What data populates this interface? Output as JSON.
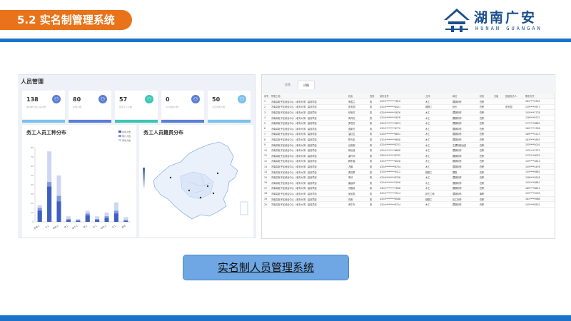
{
  "slide": {
    "title": "5.2 实名制管理系统",
    "caption": "实名制人员管理系统",
    "logo_cn": "湖南广安",
    "logo_en": "HUNAN GUANGAN",
    "colors": {
      "accent": "#e8731a",
      "band": "#1b73c9",
      "caption_bg": "#6ea7e3"
    }
  },
  "left_panel": {
    "title": "人员管理",
    "cards": [
      {
        "value": "138",
        "label": "本月累计进入总人数",
        "icon": "user-icon",
        "icon_color": "#5b7fd6",
        "bar_color": "#7cc2ea"
      },
      {
        "value": "80",
        "label": "在场人数",
        "icon": "user-icon",
        "icon_color": "#5b7fd6",
        "bar_color": "#5b7fd6"
      },
      {
        "value": "57",
        "label": "在场工人人数",
        "icon": "user-icon",
        "icon_color": "#3cc6b4",
        "bar_color": "#3cc6b4"
      },
      {
        "value": "0",
        "label": "今日进场人数",
        "icon": "user-icon",
        "icon_color": "#5b7fd6",
        "bar_color": "#5b7fd6"
      },
      {
        "value": "50",
        "label": "今日出场人数",
        "icon": "user-icon",
        "icon_color": "#7cc2ea",
        "bar_color": "#7cc2ea"
      }
    ],
    "worker_chart_title": "务工人员工种分布",
    "map_title": "务工人员籍贯分布"
  },
  "chart_data": {
    "type": "bar",
    "title": "务工人员工种分布",
    "categories": [
      "普通工",
      "木工",
      "钢筋工",
      "电工",
      "架子工",
      "焊工",
      "杂工",
      "砌筑工",
      "瓦工",
      "其他"
    ],
    "ylim": [
      0,
      80
    ],
    "yticks": [
      0,
      10,
      20,
      30,
      40,
      50,
      60,
      70,
      80
    ],
    "series": [
      {
        "name": "在场人数",
        "values": [
          12,
          38,
          22,
          2,
          1,
          7,
          2,
          4,
          9,
          1
        ],
        "color": "#3e5fbf"
      },
      {
        "name": "累计人数",
        "values": [
          15,
          43,
          28,
          3,
          2,
          9,
          3,
          6,
          12,
          2
        ],
        "color": "#7f98de"
      },
      {
        "name": "离场人数",
        "values": [
          18,
          76,
          50,
          6,
          3,
          12,
          6,
          10,
          21,
          5
        ],
        "color": "#cdd7f2"
      }
    ]
  },
  "right_panel": {
    "tabs": [
      "总览",
      "详情"
    ],
    "active_tab": 1,
    "columns": [
      "序号",
      "所属工地",
      "姓名",
      "性别",
      "身份证号",
      "工种",
      "岗位",
      "状态",
      "分组",
      "班组负责人",
      "联系方式"
    ],
    "rows": [
      [
        "1",
        "济南高老子区综合中心（老年大学）建设项目",
        "朱胜兰",
        "男",
        "4324********7810",
        "木工",
        "镶钢制作",
        "在职",
        "",
        "",
        "181****5301"
      ],
      [
        "2",
        "济南高老子区综合中心（老年大学）建设项目",
        "张天国",
        "男",
        "4324********8421",
        "钢筋工",
        "班长",
        "在职",
        "",
        "张天国",
        "139****0977"
      ],
      [
        "3",
        "济南高老子区综合中心（老年大学）建设项目",
        "何序红",
        "男",
        "4324********5876",
        "木工",
        "镶钢制作",
        "在职",
        "",
        "",
        "155****7778"
      ],
      [
        "4",
        "济南高老子区综合中心（老年大学）建设项目",
        "周开红",
        "男",
        "4324********5876",
        "木工",
        "镶钢制作",
        "在职",
        "",
        "",
        "138****8722"
      ],
      [
        "5",
        "济南高老子区综合中心（老年大学）建设项目",
        "罗茂文",
        "男",
        "4324********5874",
        "木工",
        "镶钢制作",
        "在职",
        "",
        "",
        "177****8881"
      ],
      [
        "6",
        "济南高老子区综合中心（老年大学）建设项目",
        "庞新方",
        "男",
        "4324********6770",
        "木工",
        "镶钢制作",
        "在职",
        "",
        "",
        "180****1558"
      ],
      [
        "7",
        "济南高老子区综合中心（老年大学）建设项目",
        "温红生",
        "男",
        "4324********8831",
        "木工",
        "镶钢制作",
        "在职",
        "",
        "",
        "189****4213"
      ],
      [
        "8",
        "济南高老子区综合中心（老年大学）建设项目",
        "陈光友",
        "男",
        "4324********9808",
        "木工",
        "镶钢制作",
        "在职",
        "",
        "",
        "183****5655"
      ],
      [
        "9",
        "济南高老子区综合中心（老年大学）建设项目",
        "吕则权",
        "男",
        "4324********8751",
        "木工",
        "主镶制部运送",
        "在职",
        "",
        "",
        "155****5001"
      ],
      [
        "10",
        "济南高老子区综合中心（老年大学）建设项目",
        "胡世建",
        "男",
        "4324********8808",
        "木工",
        "镶钢制作",
        "在职",
        "",
        "",
        "155****2375"
      ],
      [
        "11",
        "济南高老子区综合中心（老年大学）建设项目",
        "谢玲华",
        "男",
        "4324********8732",
        "木工",
        "镶钢制作",
        "在职",
        "",
        "",
        "173****6025"
      ],
      [
        "12",
        "济南高老子区综合中心（老年大学）建设项目",
        "滕冬福",
        "男",
        "4324********8528",
        "木工",
        "镶钢制作",
        "在职",
        "",
        "",
        "135****0813"
      ],
      [
        "13",
        "济南高老子区综合中心（老年大学）建设项目",
        "方鹏",
        "男",
        "4324********8734",
        "木工",
        "镶钢制作",
        "在职",
        "",
        "",
        "155****4476"
      ],
      [
        "14",
        "济南高老子区综合中心（老年大学）建设项目",
        "曹四季",
        "男",
        "4324********8412",
        "钢筋工",
        "镶筋",
        "在职",
        "",
        "",
        "155****6661"
      ],
      [
        "15",
        "济南高老子区综合中心（老年大学）建设项目",
        "朱好",
        "男",
        "4324********8758",
        "木工",
        "镶钢制作",
        "在职",
        "",
        "",
        "138****9518"
      ],
      [
        "16",
        "济南高老子区综合中心（老年大学）建设项目",
        "姜建华",
        "男",
        "4324********5006",
        "木工",
        "镶钢制作",
        "在职",
        "",
        "",
        "155****8881"
      ],
      [
        "17",
        "济南高老子区综合中心（老年大学）建设项目",
        "刘国兵",
        "男",
        "4324********7838",
        "木工",
        "镶钢制作",
        "在职",
        "",
        "",
        "185****8813"
      ],
      [
        "18",
        "济南高老子区综合中心（老年大学）建设项目",
        "吴景发",
        "男",
        "4324********5514",
        "其它工种",
        "镶钢制作",
        "离职",
        "",
        "",
        "155****5093"
      ],
      [
        "19",
        "济南高老子区综合中心（老年大学）建设项目",
        "向阳",
        "男",
        "4324********8588",
        "钢筋工",
        "加工制作",
        "在职",
        "",
        "",
        "181****9988"
      ],
      [
        "20",
        "济南高老子区综合中心（老年大学）建设项目",
        "黄中东",
        "男",
        "4324********8754",
        "木工",
        "镶钢制作",
        "在职",
        "",
        "",
        "155****8552"
      ]
    ]
  }
}
